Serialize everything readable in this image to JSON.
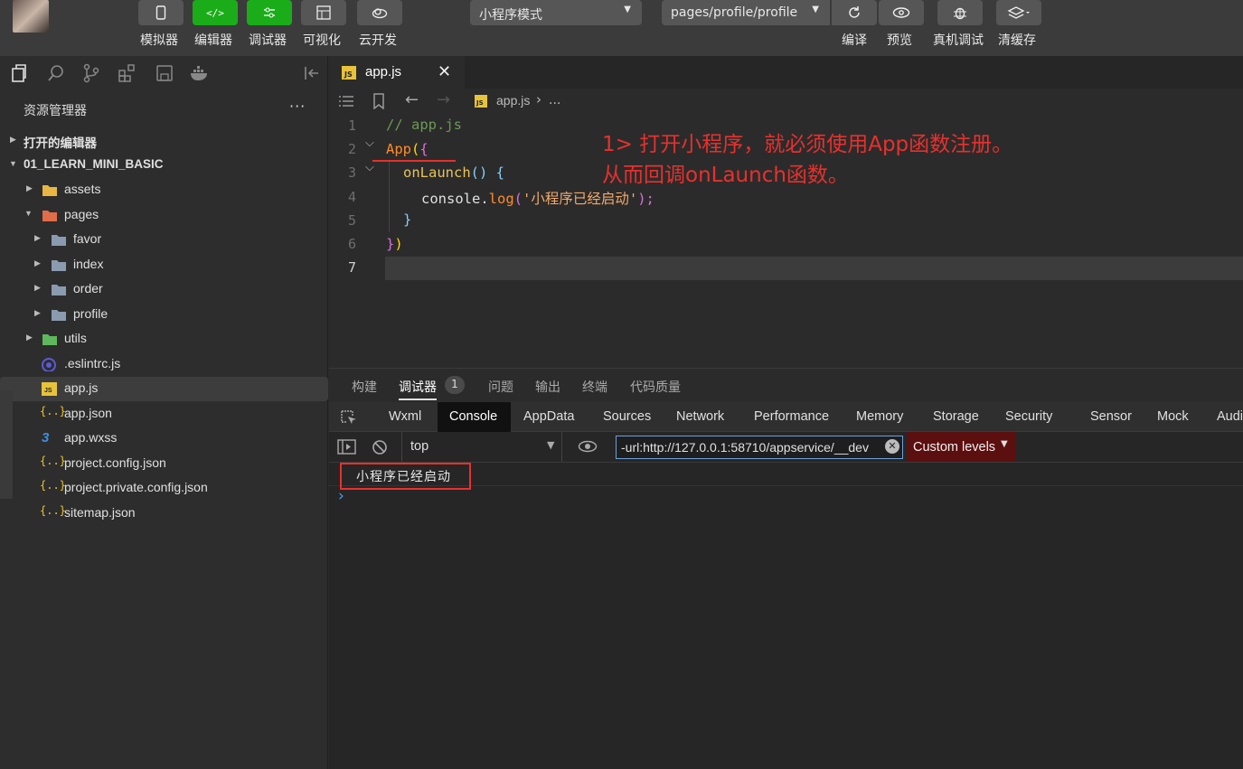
{
  "toolbar": {
    "buttons": [
      {
        "label": "模拟器",
        "icon": "phone-icon"
      },
      {
        "label": "编辑器",
        "icon": "code-icon"
      },
      {
        "label": "调试器",
        "icon": "debug-sliders-icon"
      },
      {
        "label": "可视化",
        "icon": "layout-icon"
      },
      {
        "label": "云开发",
        "icon": "cloud-icon"
      }
    ],
    "mode_select": "小程序模式",
    "page_select": "pages/profile/profile",
    "actions": [
      {
        "label": "编译",
        "icon": "refresh-icon"
      },
      {
        "label": "预览",
        "icon": "eye-icon"
      },
      {
        "label": "真机调试",
        "icon": "bug-icon"
      },
      {
        "label": "清缓存",
        "icon": "layers-icon"
      }
    ]
  },
  "sidebar": {
    "title": "资源管理器",
    "more": "···",
    "open_editors": "打开的编辑器",
    "project": "01_LEARN_MINI_BASIC",
    "items": [
      {
        "label": "assets",
        "type": "folder",
        "color": "#e8b642"
      },
      {
        "label": "pages",
        "type": "folder-open",
        "color": "#e06c4a"
      },
      {
        "label": "favor",
        "type": "folder",
        "color": "#8a9bb0"
      },
      {
        "label": "index",
        "type": "folder",
        "color": "#8a9bb0"
      },
      {
        "label": "order",
        "type": "folder",
        "color": "#8a9bb0"
      },
      {
        "label": "profile",
        "type": "folder",
        "color": "#8a9bb0"
      },
      {
        "label": "utils",
        "type": "folder",
        "color": "#5fb85b"
      },
      {
        "label": ".eslintrc.js",
        "type": "eslint",
        "color": "#5b5bd6"
      },
      {
        "label": "app.js",
        "type": "js",
        "color": "#e8c33a"
      },
      {
        "label": "app.json",
        "type": "json",
        "color": "#e8c33a"
      },
      {
        "label": "app.wxss",
        "type": "css",
        "color": "#3b8fe0"
      },
      {
        "label": "project.config.json",
        "type": "json",
        "color": "#e8c33a"
      },
      {
        "label": "project.private.config.json",
        "type": "json",
        "color": "#e8c33a"
      },
      {
        "label": "sitemap.json",
        "type": "json",
        "color": "#e8c33a"
      }
    ]
  },
  "editor": {
    "tab_label": "app.js",
    "tab_icon": "JS",
    "breadcrumb_file": "app.js",
    "breadcrumb_more": "...",
    "line_numbers": [
      "1",
      "2",
      "3",
      "4",
      "5",
      "6",
      "7"
    ],
    "code": {
      "l1": "// app.js",
      "l2_fn": "App",
      "l2_paren": "(",
      "l2_brace": "{",
      "l3_name": "onLaunch",
      "l3_rest": "() {",
      "l4_obj": "console",
      "l4_dot": ".",
      "l4_fn": "log",
      "l4_open": "(",
      "l4_str": "'小程序已经启动'",
      "l4_close": ");",
      "l5": "}",
      "l6_brace": "}",
      "l6_paren": ")"
    },
    "annotation_line1": "1> 打开小程序，就必须使用App函数注册。",
    "annotation_line2": "从而回调onLaunch函数。"
  },
  "debugger": {
    "tabs": [
      "构建",
      "调试器",
      "问题",
      "输出",
      "终端",
      "代码质量"
    ],
    "badge": "1",
    "devtools_tabs": [
      "Wxml",
      "Console",
      "AppData",
      "Sources",
      "Network",
      "Performance",
      "Memory",
      "Storage",
      "Security",
      "Sensor",
      "Mock",
      "Audi"
    ],
    "context": "top",
    "filter": "-url:http://127.0.0.1:58710/appservice/__dev",
    "levels": "Custom levels",
    "log": "小程序已经启动",
    "prompt": "›"
  },
  "colors": {
    "accent_green": "#1aad19",
    "annotation_red": "#e8302d"
  }
}
